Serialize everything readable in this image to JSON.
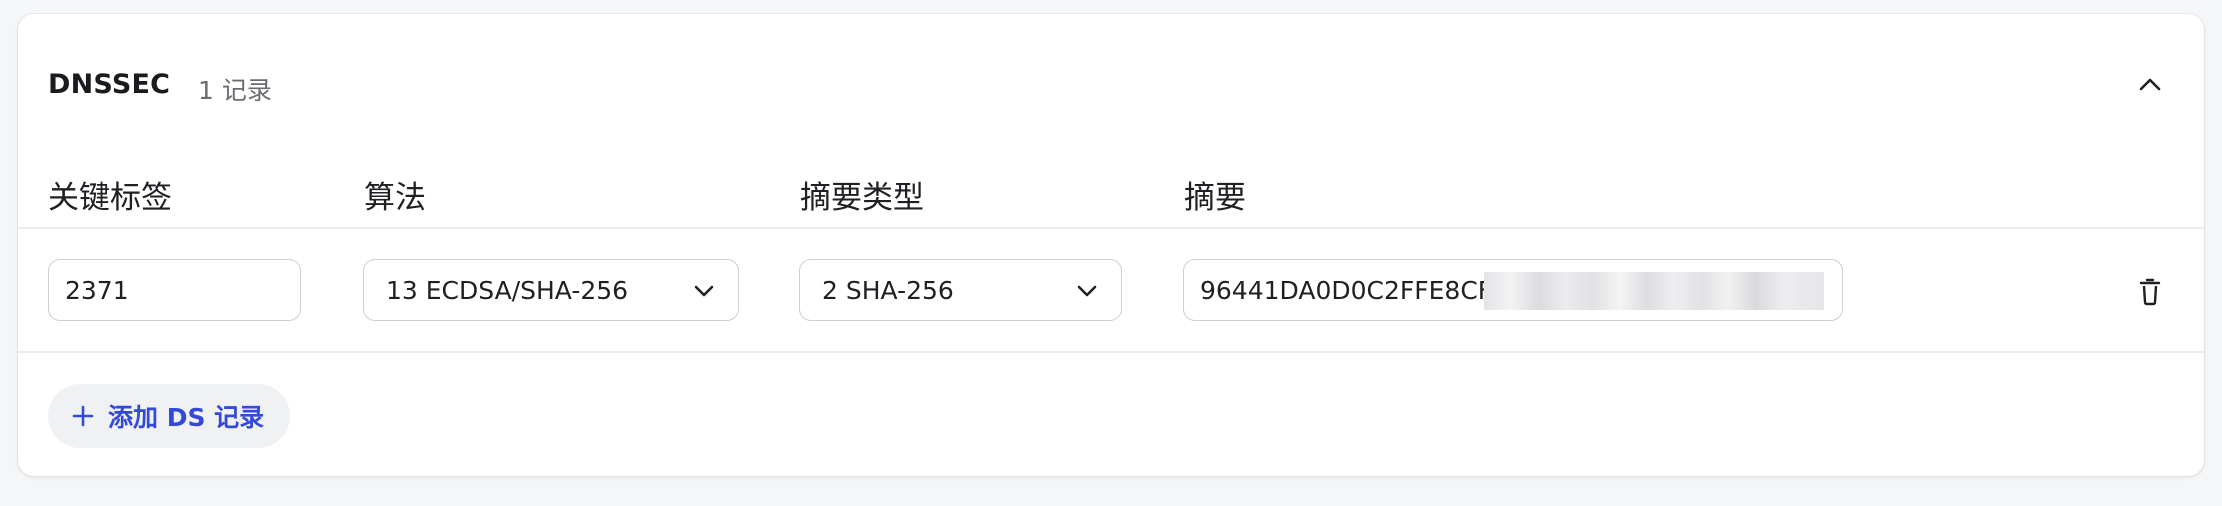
{
  "section": {
    "title": "DNSSEC",
    "record_count": "1 记录"
  },
  "columns": {
    "key_tag": "关键标签",
    "algorithm": "算法",
    "digest_type": "摘要类型",
    "digest": "摘要"
  },
  "record": {
    "key_tag": "2371",
    "algorithm": "13 ECDSA/SHA-256",
    "digest_type": "2 SHA-256",
    "digest": "96441DA0D0C2FFE8CF"
  },
  "actions": {
    "add_label": "添加 DS 记录"
  },
  "icons": {
    "collapse": "chevron-up-icon",
    "dropdown": "chevron-down-icon",
    "delete": "trash-icon",
    "add": "plus-icon"
  },
  "colors": {
    "accent": "#3349d9",
    "border": "#cfcfd4",
    "divider": "#ececef"
  }
}
